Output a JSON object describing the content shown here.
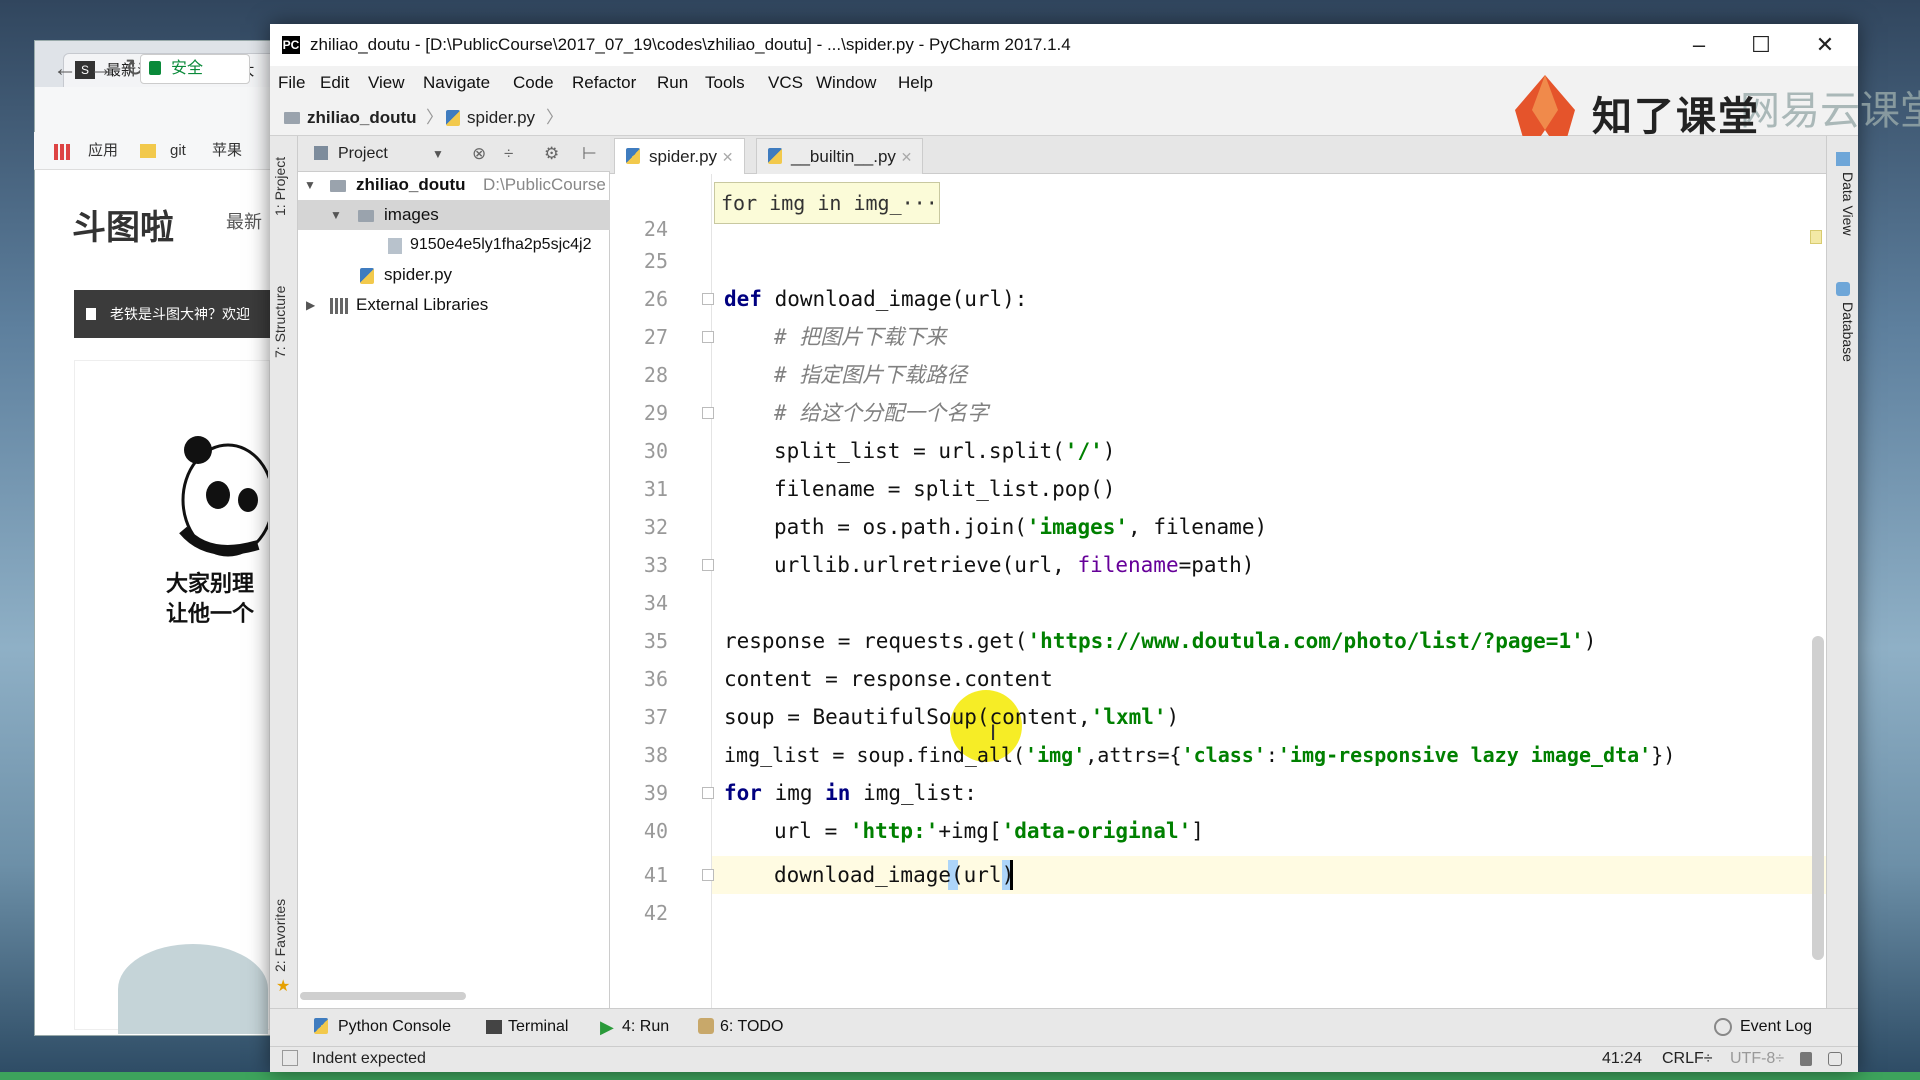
{
  "window": {
    "title": "zhiliao_doutu - [D:\\PublicCourse\\2017_07_19\\codes\\zhiliao_doutu] - ...\\spider.py - PyCharm 2017.1.4",
    "minimize": "–",
    "maximize": "☐",
    "close": "✕"
  },
  "menu": [
    "File",
    "Edit",
    "View",
    "Navigate",
    "Code",
    "Refactor",
    "Run",
    "Tools",
    "VCS",
    "Window",
    "Help"
  ],
  "navbar": {
    "project": "zhiliao_doutu",
    "file": "spider.py",
    "sep": "〉"
  },
  "watermark": {
    "brand": "知了课堂",
    "faded": "网易云课堂"
  },
  "left_strip": {
    "project": "1: Project",
    "structure": "7: Structure",
    "favorites": "2: Favorites"
  },
  "right_strip": {
    "dataview": "Data View",
    "database": "Database"
  },
  "project_panel": {
    "header": "Project",
    "root": "zhiliao_doutu",
    "root_path": "D:\\PublicCourse",
    "images": "images",
    "image_file": "9150e4e5ly1fha2p5sjc4j2",
    "spider": "spider.py",
    "external": "External Libraries"
  },
  "tabs": [
    {
      "label": "spider.py",
      "active": true
    },
    {
      "label": "__builtin__.py",
      "active": false
    }
  ],
  "breadcrumb_popup": "for img in img_···",
  "code": {
    "line_numbers": [
      "24",
      "25",
      "26",
      "27",
      "28",
      "29",
      "30",
      "31",
      "32",
      "33",
      "34",
      "35",
      "36",
      "37",
      "38",
      "39",
      "40",
      "41",
      "42"
    ],
    "l26a": "def",
    "l26b": " download_image(url):",
    "l27": "# 把图片下载下来",
    "l28": "# 指定图片下载路径",
    "l29": "# 给这个分配一个名字",
    "l30a": "split_list = url.split(",
    "l30b": "'/'",
    "l30c": ")",
    "l31": "filename = split_list.pop()",
    "l32a": "path = os.path.join(",
    "l32b": "'images'",
    "l32c": ", filename)",
    "l33a": "urllib.urlretrieve(url, ",
    "l33b": "filename",
    "l33c": "=path)",
    "l35a": "response = requests.get(",
    "l35b": "'https://www.doutula.com/photo/list/?page=1'",
    "l35c": ")",
    "l36": "content = response.content",
    "l37a": "soup = BeautifulSoup(content,",
    "l37b": "'lxml'",
    "l37c": ")",
    "l38a": "img_list = soup.find_all(",
    "l38b": "'img'",
    "l38c": ",attrs={",
    "l38d": "'class'",
    "l38e": ":",
    "l38f": "'img-responsive lazy image_dta'",
    "l38g": "})",
    "l39a": "for",
    "l39b": " img ",
    "l39c": "in",
    "l39d": " img_list:",
    "l40a": "url = ",
    "l40b": "'http:'",
    "l40c": "+img[",
    "l40d": "'data-original'",
    "l40e": "]",
    "l41": "download_image(url)"
  },
  "toolwindows": {
    "console": "Python Console",
    "terminal": "Terminal",
    "run": "4: Run",
    "todo": "6: TODO",
    "eventlog": "Event Log"
  },
  "status": {
    "message": "Indent expected",
    "position": "41:24",
    "line_sep": "CRLF÷",
    "encoding": "UTF-8÷"
  },
  "browser": {
    "tab_title": "最新斗图表情 - 斗图大",
    "secure": "安全",
    "bookmarks": [
      "应用",
      "git",
      "苹果"
    ],
    "site_logo": "斗图啦",
    "site_nav": "最新",
    "announce": "老铁是斗图大神？欢迎",
    "meme_line1": "大家别理",
    "meme_line2": "让他一个"
  },
  "colors": {
    "keyword": "#000080",
    "string": "#008000",
    "comment": "#808080",
    "param": "#660099",
    "current_line": "#fffbe2"
  }
}
